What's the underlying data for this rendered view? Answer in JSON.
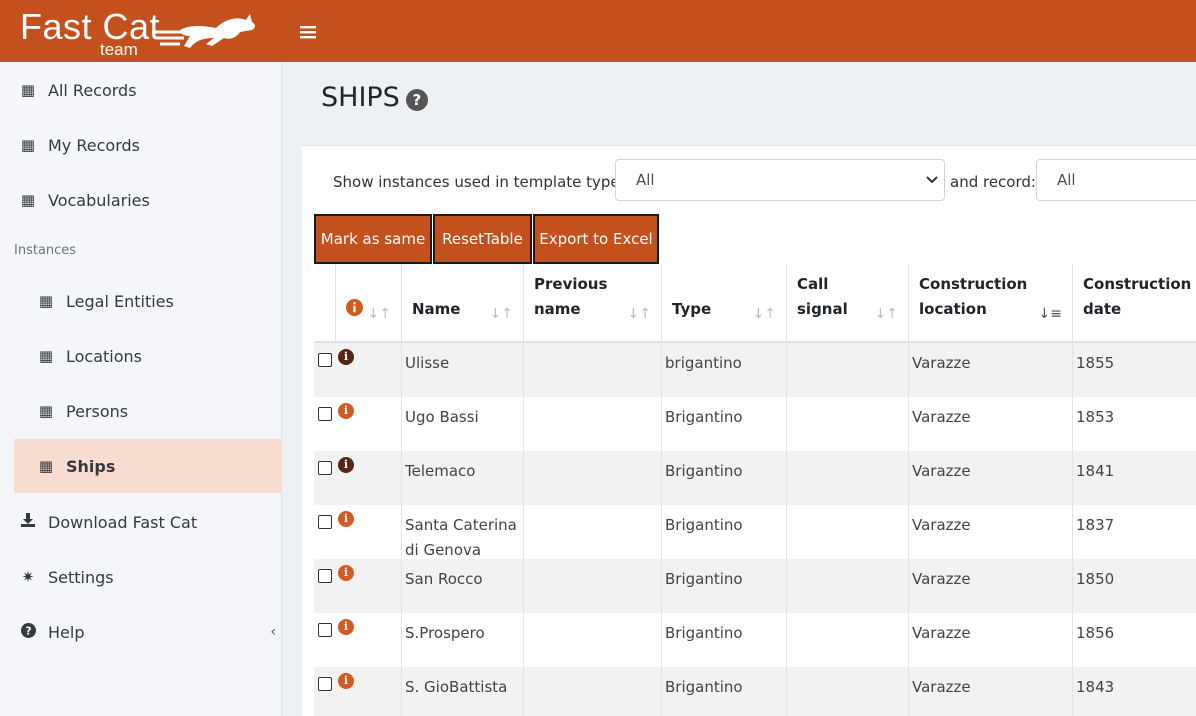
{
  "header": {
    "brand_main": "Fast Cat",
    "brand_sub": "team",
    "menu_icon": "hamburger-icon"
  },
  "sidebar": {
    "items": [
      {
        "label": "All Records",
        "icon": "table-icon"
      },
      {
        "label": "My Records",
        "icon": "table-icon"
      },
      {
        "label": "Vocabularies",
        "icon": "table-icon"
      }
    ],
    "section_header": "Instances",
    "instances": [
      {
        "label": "Legal Entities",
        "icon": "table-icon"
      },
      {
        "label": "Locations",
        "icon": "table-icon"
      },
      {
        "label": "Persons",
        "icon": "table-icon"
      },
      {
        "label": "Ships",
        "icon": "table-icon",
        "active": true
      }
    ],
    "bottom_items": [
      {
        "label": "Download Fast Cat",
        "icon": "download-icon"
      },
      {
        "label": "Settings",
        "icon": "gear-icon"
      },
      {
        "label": "Help",
        "icon": "question-circle-icon"
      }
    ],
    "collapse_icon": "chevron-left-icon",
    "collapse_glyph": "‹"
  },
  "page": {
    "title": "SHIPS",
    "help_glyph": "?"
  },
  "filters": {
    "template_label": "Show instances used in template type:",
    "template_value": "All",
    "record_label": "and record:",
    "record_value": "All"
  },
  "buttons": {
    "mark_same": "Mark as same",
    "reset_table": "ResetTable",
    "export_excel": "Export to Excel"
  },
  "table": {
    "columns": [
      {
        "label": "Name"
      },
      {
        "label": "Previous name"
      },
      {
        "label": "Type"
      },
      {
        "label": "Call signal"
      },
      {
        "label": "Construction location",
        "sorted": "desc"
      },
      {
        "label": "Construction date"
      }
    ],
    "rows": [
      {
        "info_color": "#5a2416",
        "name": "Ulisse",
        "previous_name": "",
        "type": "brigantino",
        "call_signal": "",
        "location": "Varazze",
        "date": "1855"
      },
      {
        "info_color": "#d6591f",
        "name": "Ugo Bassi",
        "previous_name": "",
        "type": "Brigantino",
        "call_signal": "",
        "location": "Varazze",
        "date": "1853"
      },
      {
        "info_color": "#5a2416",
        "name": "Telemaco",
        "previous_name": "",
        "type": "Brigantino",
        "call_signal": "",
        "location": "Varazze",
        "date": "1841"
      },
      {
        "info_color": "#d6591f",
        "name": "Santa Caterina di Genova",
        "previous_name": "",
        "type": "Brigantino",
        "call_signal": "",
        "location": "Varazze",
        "date": "1837"
      },
      {
        "info_color": "#d6591f",
        "name": "San Rocco",
        "previous_name": "",
        "type": "Brigantino",
        "call_signal": "",
        "location": "Varazze",
        "date": "1850"
      },
      {
        "info_color": "#d6591f",
        "name": "S.Prospero",
        "previous_name": "",
        "type": "Brigantino",
        "call_signal": "",
        "location": "Varazze",
        "date": "1856"
      },
      {
        "info_color": "#d6591f",
        "name": "S. GioBattista",
        "previous_name": "",
        "type": "Brigantino",
        "call_signal": "",
        "location": "Varazze",
        "date": "1843"
      }
    ]
  },
  "colors": {
    "brand": "#c4501e",
    "active_bg": "#f7dcd0",
    "info_dark": "#5a2416",
    "info_orange": "#d6591f"
  }
}
